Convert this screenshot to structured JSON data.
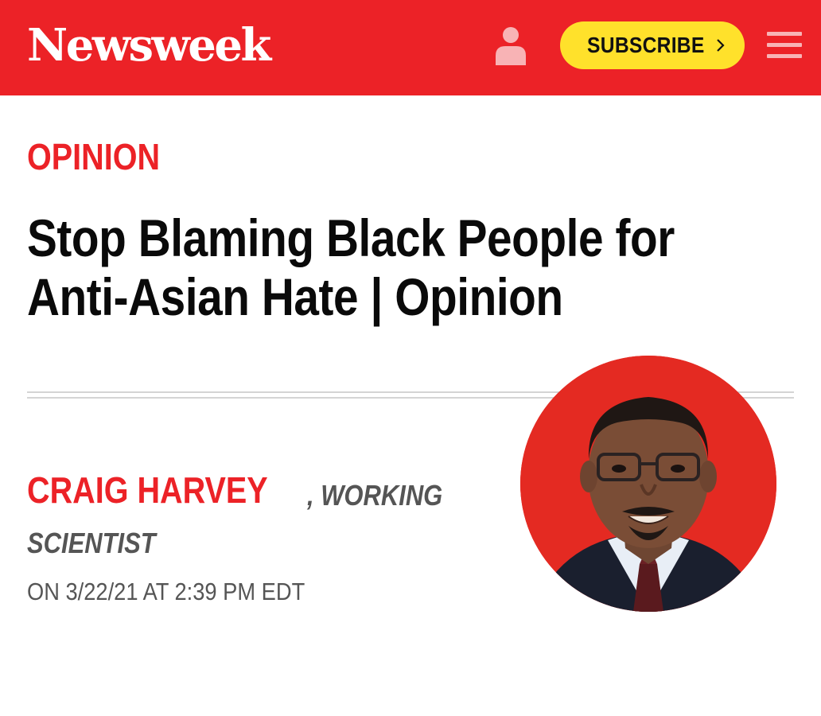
{
  "header": {
    "logo_text": "Newsweek",
    "subscribe_label": "SUBSCRIBE",
    "background_color": "#ec2227",
    "subscribe_color": "#ffe12b",
    "account_icon": "user-icon",
    "menu_icon": "hamburger-menu-icon",
    "subscribe_icon": "chevron-right-icon"
  },
  "article": {
    "section": "OPINION",
    "title_line_1": "Stop Blaming Black People for",
    "title_line_2": "Anti-Asian Hate | Opinion",
    "author": {
      "name": "CRAIG HARVEY",
      "role_part_1": ", WORKING",
      "role_part_2": "SCIENTIST",
      "photo": "author-headshot"
    },
    "dateline": "ON 3/22/21 AT 2:39 PM EDT"
  }
}
